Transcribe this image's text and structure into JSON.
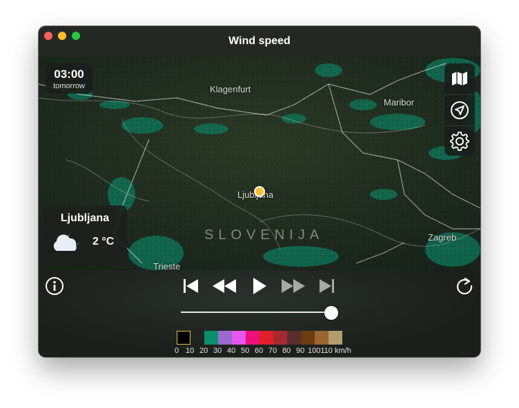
{
  "window": {
    "title": "Wind speed"
  },
  "time": {
    "value": "03:00",
    "day": "tomorrow"
  },
  "map": {
    "country": "SLOVENIJA",
    "cities": [
      "Klagenfurt",
      "Maribor",
      "Ljubljana",
      "Zagreb",
      "Trieste"
    ]
  },
  "tools": [
    {
      "name": "map-layers",
      "icon": "map-icon"
    },
    {
      "name": "location",
      "icon": "navigation-arrow-icon"
    },
    {
      "name": "settings",
      "icon": "gear-icon"
    }
  ],
  "weather": {
    "city": "Ljubljana",
    "temp": "2 °C",
    "icon": "partly-cloudy-night-icon"
  },
  "controls": {
    "icons": [
      "info-icon",
      "skip-back-icon",
      "rewind-icon",
      "play-icon",
      "fast-forward-icon",
      "skip-forward-icon",
      "refresh-icon"
    ],
    "timeline_position": 0.98
  },
  "legend": {
    "unit": "km/h",
    "colors": [
      "#000000",
      "#0b8f6a",
      "#9b6ad0",
      "#e457f0",
      "#f0107a",
      "#e0202a",
      "#a62a30",
      "#5a2e2e",
      "#6b3d10",
      "#9b6530",
      "#b59c6c"
    ],
    "labels": [
      "0",
      "10",
      "20",
      "30",
      "40",
      "50",
      "60",
      "70",
      "80",
      "90",
      "100110",
      "km/h"
    ]
  }
}
